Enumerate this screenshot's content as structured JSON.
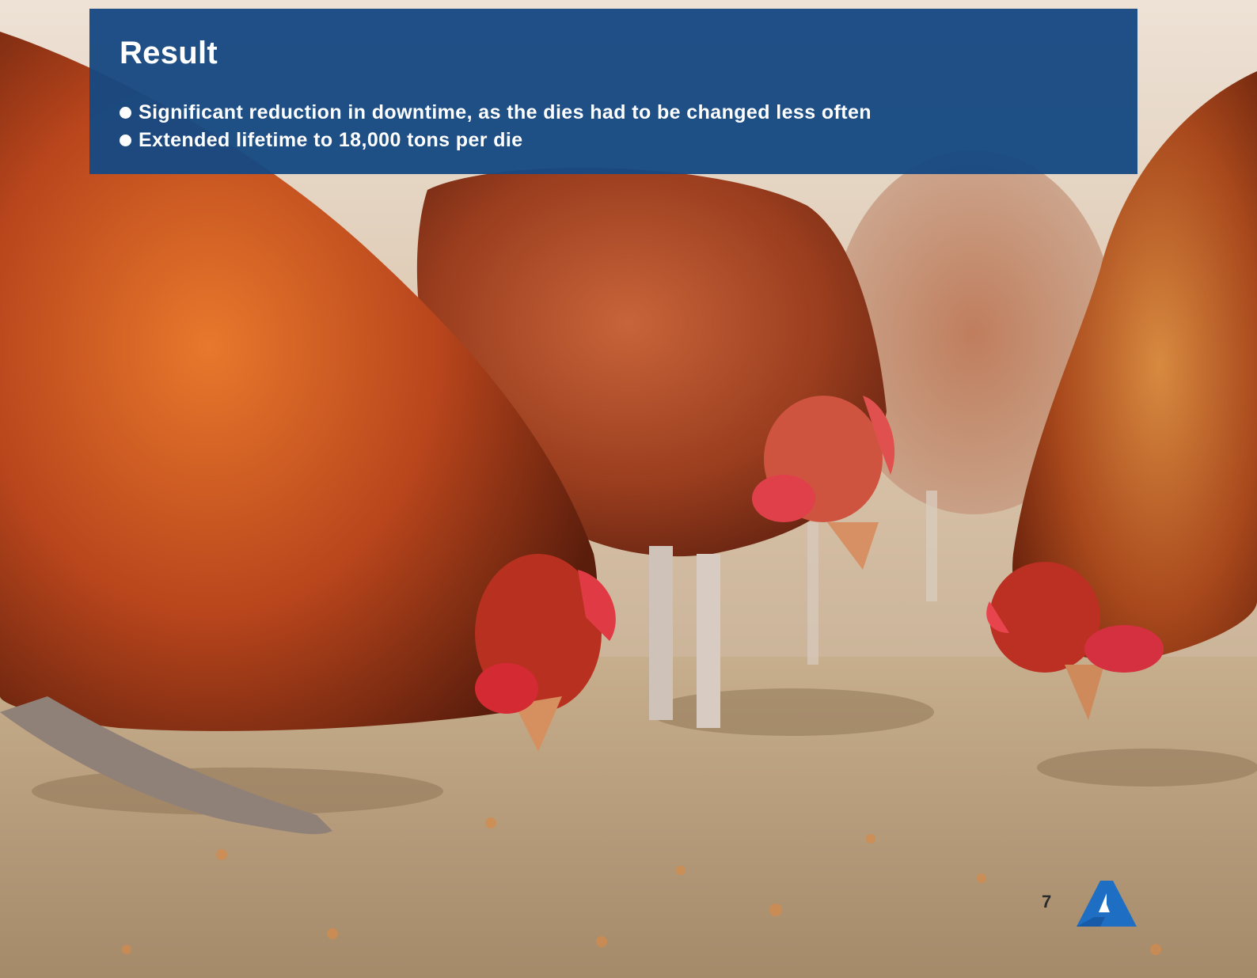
{
  "result": {
    "title": "Result",
    "items": [
      "Significant reduction in downtime, as the dies had to be changed less often",
      "Extended lifetime to 18,000 tons per die"
    ]
  },
  "footer": {
    "page_number": "7",
    "logo_icon": "company-triangle-logo-icon"
  },
  "colors": {
    "box_background": "#164982",
    "logo_blue": "#1e6fc4",
    "text_white": "#ffffff"
  }
}
